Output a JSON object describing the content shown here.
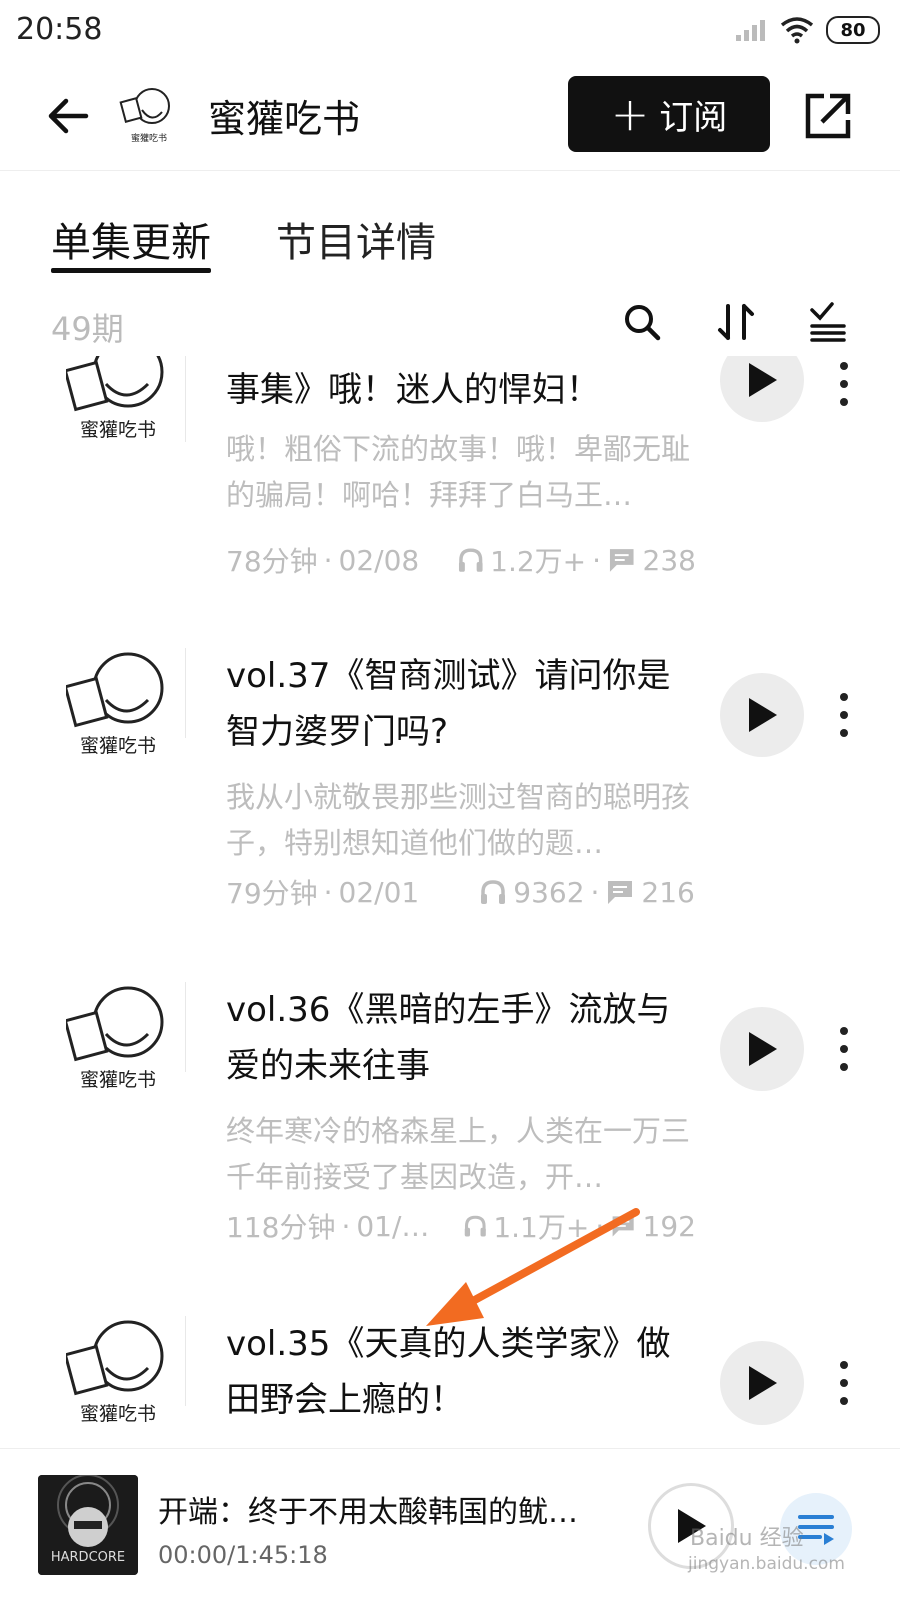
{
  "status_bar": {
    "time": "20:58",
    "battery": "80"
  },
  "header": {
    "title": "蜜獾吃书",
    "subscribe_label": "订阅"
  },
  "tabs": [
    {
      "label": "单集更新"
    },
    {
      "label": "节目详情"
    }
  ],
  "list_header": {
    "count": "49期"
  },
  "episodes": [
    {
      "title": "事集》哦！迷人的悍妇！",
      "description": "哦！粗俗下流的故事！哦！卑鄙无耻的骗局！啊哈！拜拜了白马王…",
      "duration": "78分钟",
      "date": "02/08",
      "plays": "1.2万+",
      "comments": "238"
    },
    {
      "title": "vol.37《智商测试》请问你是智力婆罗门吗?",
      "description": "我从小就敬畏那些测过智商的聪明孩子，特别想知道他们做的题…",
      "duration": "79分钟",
      "date": "02/01",
      "plays": "9362",
      "comments": "216"
    },
    {
      "title": "vol.36《黑暗的左手》流放与爱的未来往事",
      "description": "终年寒冷的格森星上，人类在一万三千年前接受了基因改造，开…",
      "duration": "118分钟",
      "date": "01/…",
      "plays": "1.1万+",
      "comments": "192"
    },
    {
      "title": "vol.35《天真的人类学家》做田野会上瘾的！",
      "description": "",
      "duration": "",
      "date": "",
      "plays": "",
      "comments": ""
    }
  ],
  "player": {
    "title": "开端：终于不用太酸韩国的鱿…",
    "time": "00:00/1:45:18"
  },
  "watermark": {
    "line1": "Baidu 经验",
    "line2": "jingyan.baidu.com"
  },
  "colors": {
    "accent_dark": "#111111",
    "muted_text": "#bdbdbd",
    "arrow": "#f26b21"
  },
  "icons": [
    "back-arrow-icon",
    "share-icon",
    "search-icon",
    "sort-icon",
    "filter-icon",
    "headphones-icon",
    "comment-icon",
    "play-icon",
    "more-icon",
    "playlist-icon"
  ]
}
